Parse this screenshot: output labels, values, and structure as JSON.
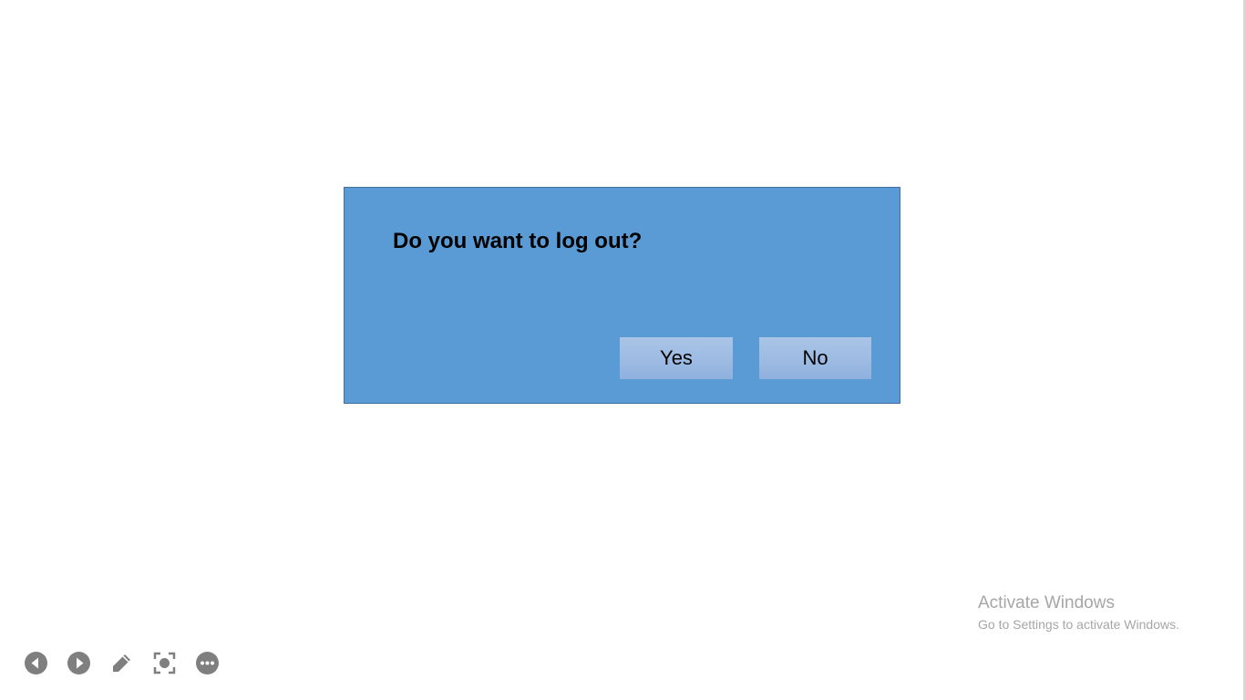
{
  "dialog": {
    "message": "Do you want to log out?",
    "yes_label": "Yes",
    "no_label": "No",
    "background_color": "#5b9bd5",
    "button_color": "#9cbae2"
  },
  "watermark": {
    "title": "Activate Windows",
    "subtitle": "Go to Settings to activate Windows."
  },
  "slideshow_toolbar": {
    "items": [
      {
        "name": "previous",
        "icon": "previous-arrow-icon"
      },
      {
        "name": "next",
        "icon": "next-arrow-icon"
      },
      {
        "name": "pen",
        "icon": "pen-icon"
      },
      {
        "name": "zoom",
        "icon": "zoom-focus-icon"
      },
      {
        "name": "more",
        "icon": "more-options-icon"
      }
    ],
    "icon_color": "#7f7f7f"
  }
}
